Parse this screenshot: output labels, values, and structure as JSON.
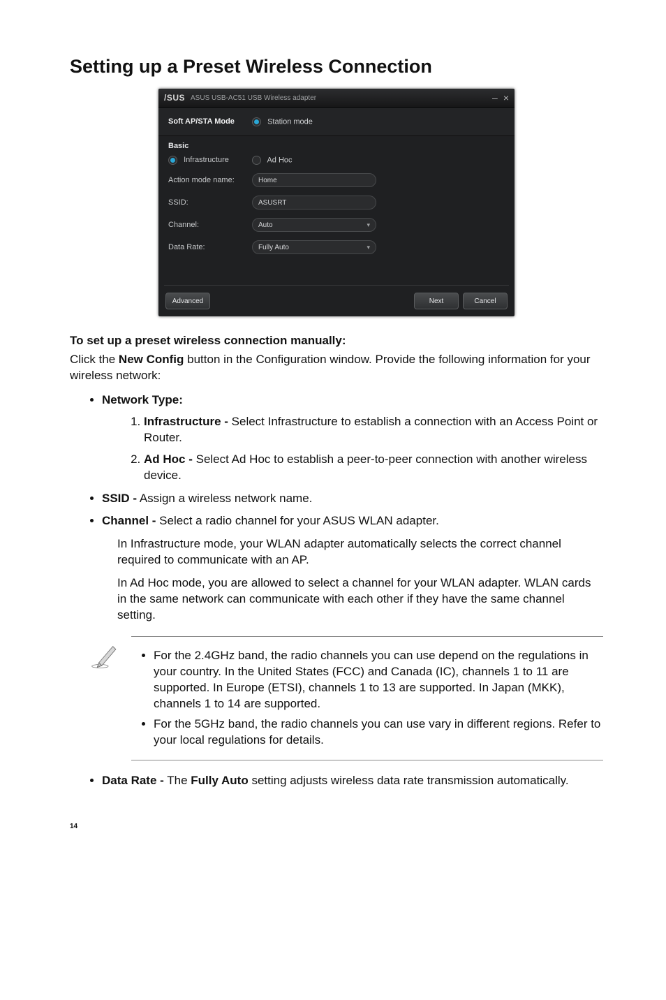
{
  "title": "Setting up a Preset Wireless Connection",
  "dialog": {
    "logo": "/SUS",
    "subtitle": "ASUS USB-AC51 USB Wireless adapter",
    "mode_label": "Soft AP/STA Mode",
    "mode_value": "Station mode",
    "section": "Basic",
    "radio_infra": "Infrastructure",
    "radio_adhoc": "Ad Hoc",
    "lbl_action": "Action mode name:",
    "val_action": "Home",
    "lbl_ssid": "SSID:",
    "val_ssid": "ASUSRT",
    "lbl_channel": "Channel:",
    "val_channel": "Auto",
    "lbl_rate": "Data Rate:",
    "val_rate": "Fully Auto",
    "btn_adv": "Advanced",
    "btn_next": "Next",
    "btn_cancel": "Cancel"
  },
  "setup_heading": "To set up a preset wireless connection manually:",
  "setup_click_pre": "Click the ",
  "setup_click_bold": "New Config",
  "setup_click_post": " button in the Configuration window. Provide the following information for your wireless network:",
  "net_type_label": "Network Type:",
  "infra_bold": "Infrastructure -",
  "infra_text": " Select Infrastructure to establish a connection with an Access Point or Router.",
  "adhoc_bold": "Ad Hoc -",
  "adhoc_text": " Select Ad Hoc to establish a peer-to-peer connection with another wireless device.",
  "ssid_bold": "SSID -",
  "ssid_text": " Assign a wireless network name.",
  "channel_bold": "Channel -",
  "channel_text": " Select a radio channel for your ASUS WLAN adapter.",
  "channel_p1": "In Infrastructure mode, your WLAN adapter automatically selects the correct channel required to communicate with an AP.",
  "channel_p2": "In Ad Hoc mode, you are allowed to select a channel for your WLAN adapter. WLAN cards in the same network can communicate with each other if they have the same channel setting.",
  "note1": "For the 2.4GHz band, the radio channels you can use depend on the regulations in your country. In the United States (FCC) and Canada (IC), channels 1 to 11 are supported. In Europe (ETSI), channels 1 to 13 are supported. In Japan (MKK), channels 1 to 14 are supported.",
  "note2": "For the 5GHz band, the radio channels you can use vary in different regions. Refer to your local regulations for details.",
  "rate_bold1": "Data Rate -",
  "rate_mid": " The ",
  "rate_bold2": "Fully Auto",
  "rate_post": " setting adjusts wireless data rate transmission automatically.",
  "page_num": "14"
}
